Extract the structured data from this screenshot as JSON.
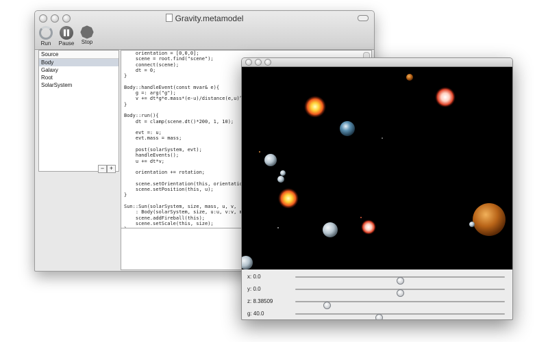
{
  "editor": {
    "title": "Gravity.metamodel",
    "toolbar": {
      "run": "Run",
      "pause": "Pause",
      "stop": "Stop"
    },
    "sidebar": {
      "header": "Source",
      "items": [
        "Body",
        "Galaxy",
        "Root",
        "SolarSystem"
      ],
      "selected": "Body"
    },
    "add_label": "+",
    "remove_label": "−",
    "code_lines": [
      "    orientation = [0,0,0];",
      "    scene = root.find(\"scene\");",
      "    connect(scene);",
      "    dt = 0;",
      "}",
      "",
      "Body::handleEvent(const mvar& e){",
      "    g =: arg(\"g\");",
      "    v += dt*g*e.mass*(e-u)/distance(e,u)^2",
      "}",
      "",
      "Body::run(){",
      "    dt = clamp(scene.dt()*200, 1, 10);",
      "",
      "    evt =: u;",
      "    evt.mass = mass;",
      "",
      "    post(solarSystem, evt);",
      "    handleEvents();",
      "    u += dt*v;",
      "",
      "    orientation += rotation;",
      "",
      "    scene.setOrientation(this, orientation",
      "    scene.setPosition(this, u);",
      "}",
      "",
      "Sun::Sun(solarSystem, size, mass, u, v,",
      "    : Body(solarSystem, size, u:u, v:v, ma",
      "    scene.addFireball(this);",
      "    scene.setScale(this, size);",
      "}"
    ]
  },
  "simulation": {
    "sliders": [
      {
        "label": "x: 0.0",
        "value": 0.5
      },
      {
        "label": "y: 0.0",
        "value": 0.5
      },
      {
        "label": "z: 8.38509",
        "value": 0.15
      },
      {
        "label": "g: 40.0",
        "value": 0.4
      }
    ]
  }
}
